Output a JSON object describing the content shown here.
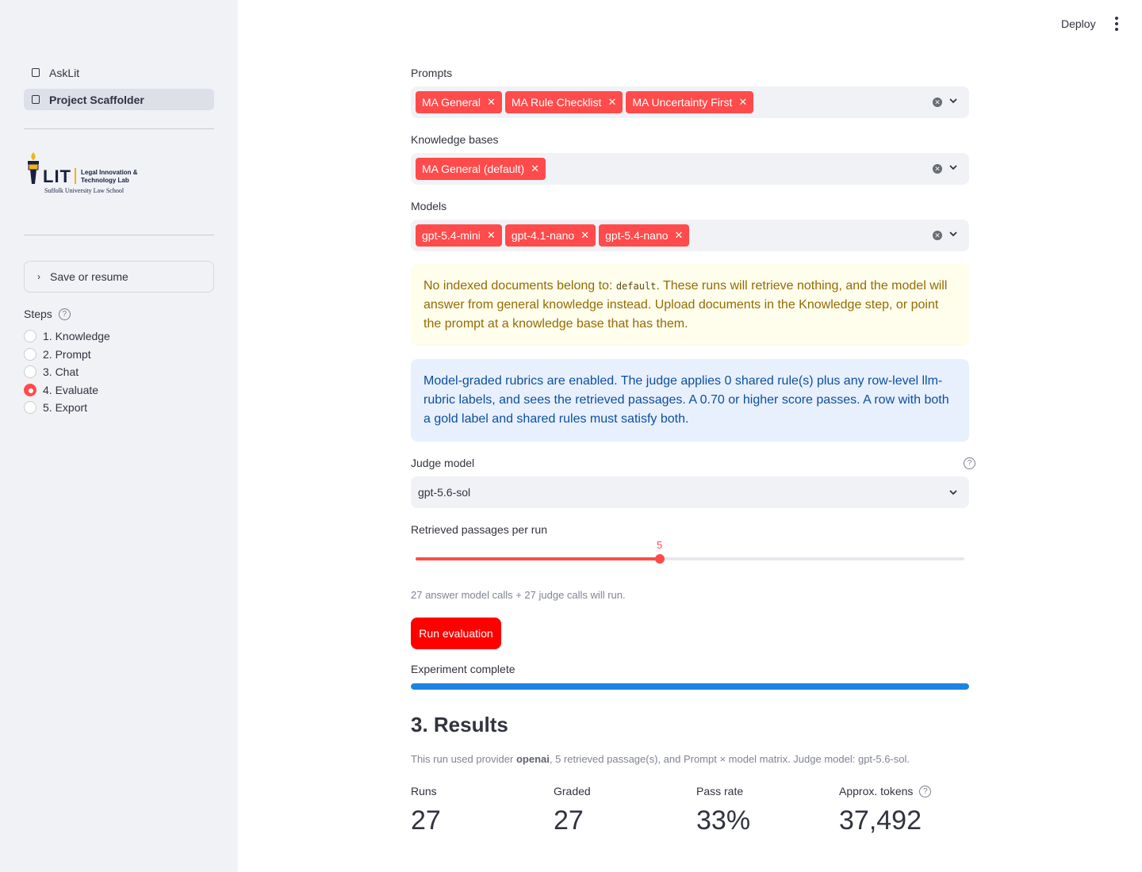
{
  "header": {
    "deploy_label": "Deploy"
  },
  "sidebar": {
    "nav": [
      {
        "label": "AskLit",
        "active": false
      },
      {
        "label": "Project Scaffolder",
        "active": true
      }
    ],
    "logo": {
      "mark": "LIT",
      "line1": "Legal Innovation &",
      "line2": "Technology Lab",
      "school": "Suffolk University Law School"
    },
    "expander_label": "Save or resume",
    "steps_label": "Steps",
    "steps": [
      "1. Knowledge",
      "2. Prompt",
      "3. Chat",
      "4. Evaluate",
      "5. Export"
    ],
    "selected_step": "4. Evaluate"
  },
  "main": {
    "prompts": {
      "label": "Prompts",
      "selected": [
        "MA General",
        "MA Rule Checklist",
        "MA Uncertainty First"
      ]
    },
    "knowledge_bases": {
      "label": "Knowledge bases",
      "selected": [
        "MA General (default)"
      ]
    },
    "models": {
      "label": "Models",
      "selected": [
        "gpt-5.4-mini",
        "gpt-4.1-nano",
        "gpt-5.4-nano"
      ]
    },
    "warning": {
      "before": "No indexed documents belong to: ",
      "code": "default",
      "after": ". These runs will retrieve nothing, and the model will answer from general knowledge instead. Upload documents in the Knowledge step, or point the prompt at a knowledge base that has them."
    },
    "info": "Model-graded rubrics are enabled. The judge applies 0 shared rule(s) plus any row-level llm-rubric labels, and sees the retrieved passages. A 0.70 or higher score passes. A row with both a gold label and shared rules must satisfy both.",
    "judge": {
      "label": "Judge model",
      "value": "gpt-5.6-sol"
    },
    "slider": {
      "label": "Retrieved passages per run",
      "value": "5",
      "fraction": 0.445
    },
    "calls_caption": "27 answer model calls + 27 judge calls will run.",
    "run_button": "Run evaluation",
    "progress": {
      "label": "Experiment complete",
      "fraction": 1.0
    },
    "results": {
      "heading": "3. Results",
      "caption_parts": {
        "p1": "This run used provider ",
        "provider": "openai",
        "p2": ", 5 retrieved passage(s), and Prompt × model matrix. Judge model: gpt-5.6-sol."
      },
      "metrics": [
        {
          "label": "Runs",
          "value": "27"
        },
        {
          "label": "Graded",
          "value": "27"
        },
        {
          "label": "Pass rate",
          "value": "33%"
        },
        {
          "label": "Approx. tokens",
          "value": "37,492"
        }
      ]
    }
  },
  "colors": {
    "accent": "#ff4b4b",
    "primary_button": "#ff0000",
    "progress": "#1c83e1",
    "sidebar_bg": "#f0f2f6"
  }
}
